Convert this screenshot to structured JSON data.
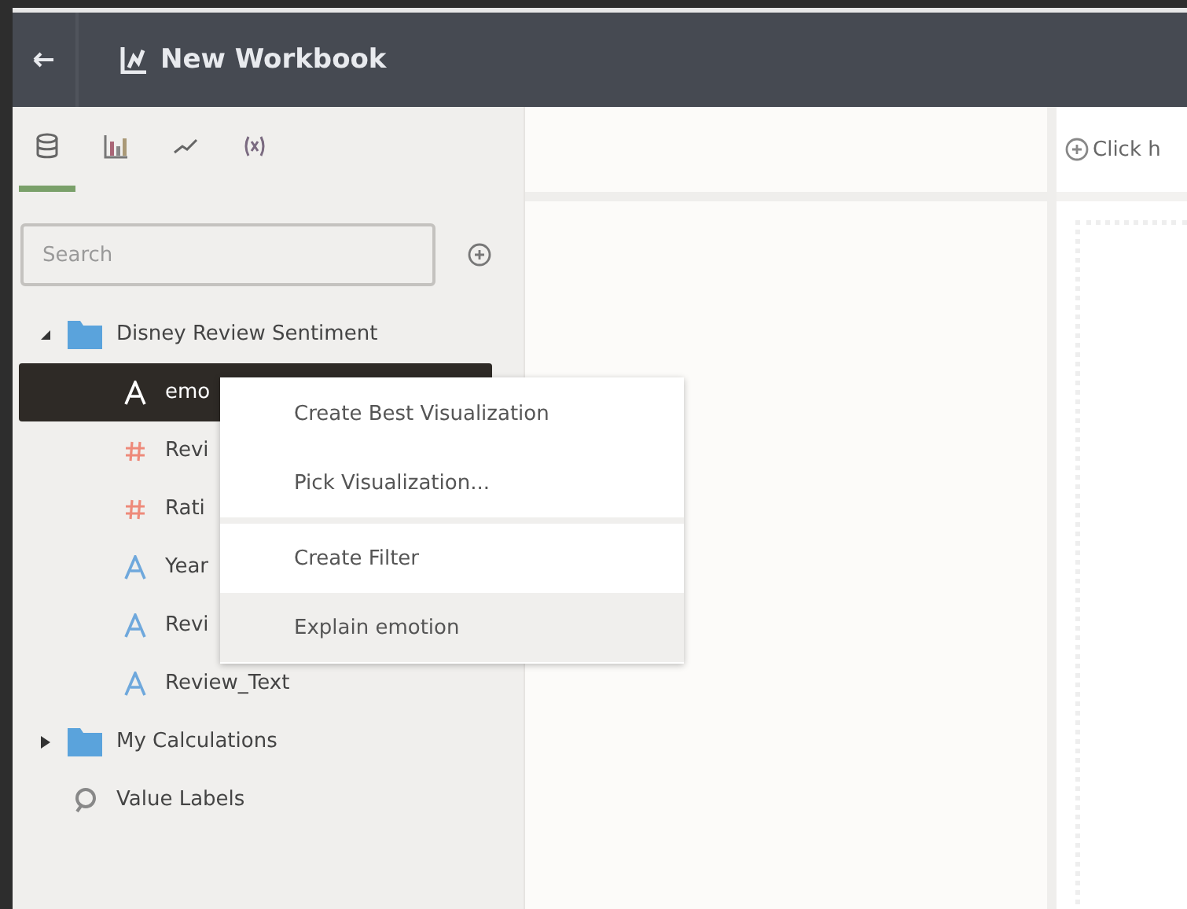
{
  "window": {
    "title": "New Workbook"
  },
  "tabs": [
    {
      "kind": "data",
      "selected": true
    },
    {
      "kind": "chart",
      "selected": false
    },
    {
      "kind": "trend",
      "selected": false
    },
    {
      "kind": "variables",
      "selected": false
    }
  ],
  "search": {
    "placeholder": "Search"
  },
  "tree": [
    {
      "label": "Disney Review Sentiment",
      "kind": "folder",
      "expanded": true,
      "children": [
        {
          "label": "emo",
          "kind": "text",
          "selected": true
        },
        {
          "label": "Revi",
          "kind": "number",
          "selected": false
        },
        {
          "label": "Rati",
          "kind": "number",
          "selected": false
        },
        {
          "label": "Year",
          "kind": "text",
          "selected": false
        },
        {
          "label": "Revi",
          "kind": "text",
          "selected": false
        },
        {
          "label": "Review_Text",
          "kind": "text",
          "selected": false
        }
      ]
    },
    {
      "label": "My Calculations",
      "kind": "folder",
      "expanded": false
    },
    {
      "label": "Value Labels",
      "kind": "tag"
    }
  ],
  "context_menu": [
    {
      "label": "Create Best Visualization",
      "selected": false,
      "divider_before": false
    },
    {
      "label": "Pick Visualization...",
      "selected": false,
      "divider_before": false
    },
    {
      "label": "Create Filter",
      "selected": false,
      "divider_before": true
    },
    {
      "label": "Explain emotion",
      "selected": true,
      "divider_before": false
    }
  ],
  "canvas": {
    "hint": "Click h"
  }
}
